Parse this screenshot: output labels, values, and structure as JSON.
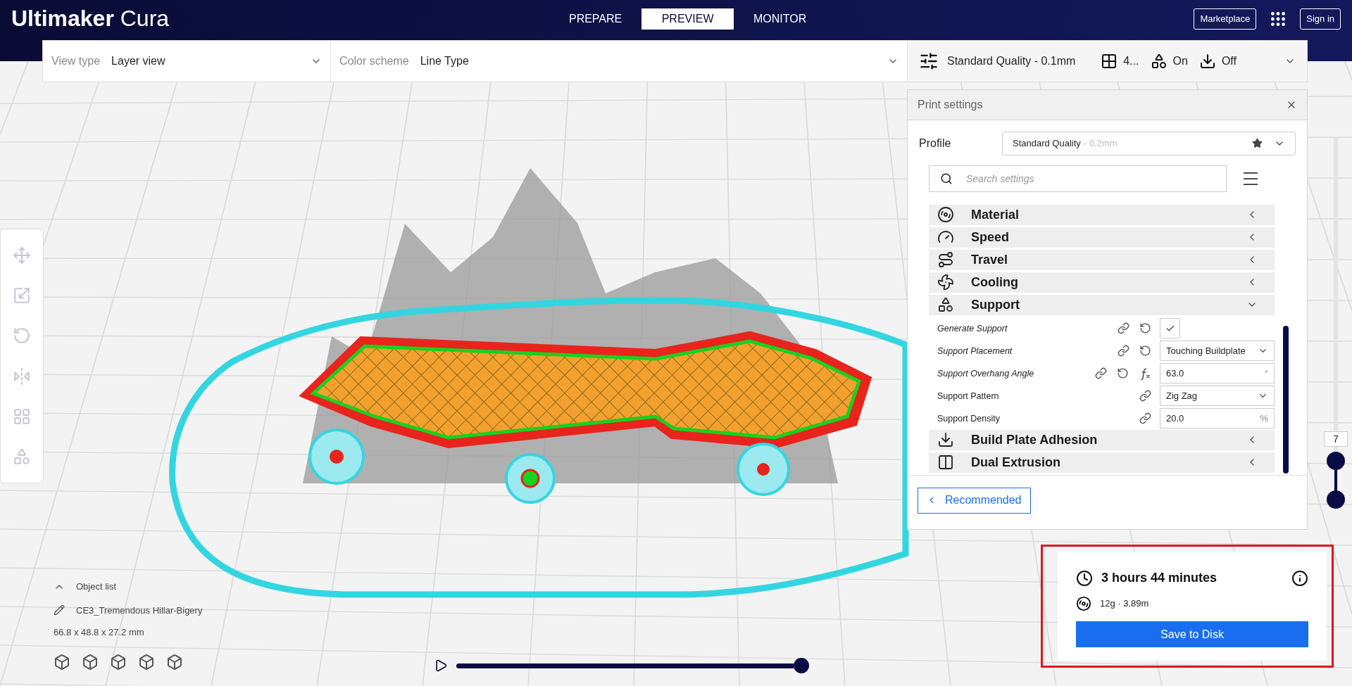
{
  "app": {
    "title_bold": "Ultimaker",
    "title_light": "Cura"
  },
  "stages": [
    {
      "label": "PREPARE",
      "selected": false
    },
    {
      "label": "PREVIEW",
      "selected": true
    },
    {
      "label": "MONITOR",
      "selected": false
    }
  ],
  "header_actions": {
    "marketplace": "Marketplace",
    "sign_in": "Sign in"
  },
  "view_bar": {
    "view_type_label": "View type",
    "view_type": "Layer view",
    "color_scheme_label": "Color scheme",
    "color_scheme": "Line Type"
  },
  "print_setup_bar": {
    "profile": "Standard Quality - 0.1mm",
    "infill": "4...",
    "support": "On",
    "adhesion": "Off"
  },
  "print_settings": {
    "title": "Print settings",
    "profile_label": "Profile",
    "profile_name": "Standard Quality",
    "profile_detail": "- 0.2mm",
    "search": {
      "placeholder": "Search settings"
    },
    "rows": [
      {
        "kind": "category",
        "label": "Material",
        "expanded": false
      },
      {
        "kind": "category",
        "label": "Speed",
        "expanded": false
      },
      {
        "kind": "category",
        "label": "Travel",
        "expanded": false
      },
      {
        "kind": "category",
        "label": "Cooling",
        "expanded": false
      },
      {
        "kind": "category",
        "label": "Support",
        "expanded": true
      },
      {
        "kind": "checkbox",
        "label": "Generate Support",
        "changed": true,
        "formula": false,
        "checked": true
      },
      {
        "kind": "dropdown",
        "label": "Support Placement",
        "changed": true,
        "formula": false,
        "value": "Touching Buildplate"
      },
      {
        "kind": "number",
        "label": "Support Overhang Angle",
        "changed": true,
        "formula": true,
        "value": "63.0",
        "unit": "°"
      },
      {
        "kind": "dropdown",
        "label": "Support Pattern",
        "changed": false,
        "formula": false,
        "value": "Zig Zag"
      },
      {
        "kind": "number",
        "label": "Support Density",
        "changed": false,
        "formula": false,
        "value": "20.0",
        "unit": "%"
      },
      {
        "kind": "category",
        "label": "Build Plate Adhesion",
        "expanded": false
      },
      {
        "kind": "category",
        "label": "Dual Extrusion",
        "expanded": false
      }
    ],
    "recommended_button": "Recommended"
  },
  "layer_slider": {
    "reading": "7",
    "level": 0.11
  },
  "simulation": {
    "level": 1
  },
  "object_list": {
    "label": "Object list",
    "object_name": "CE3_Tremendous Hillar-Bigery",
    "dimensions": "66.8 x 48.8 x 27.2 mm"
  },
  "estimate": {
    "time": "3 hours 44 minutes",
    "material": "12g · 3.89m",
    "action": "Save to Disk"
  }
}
